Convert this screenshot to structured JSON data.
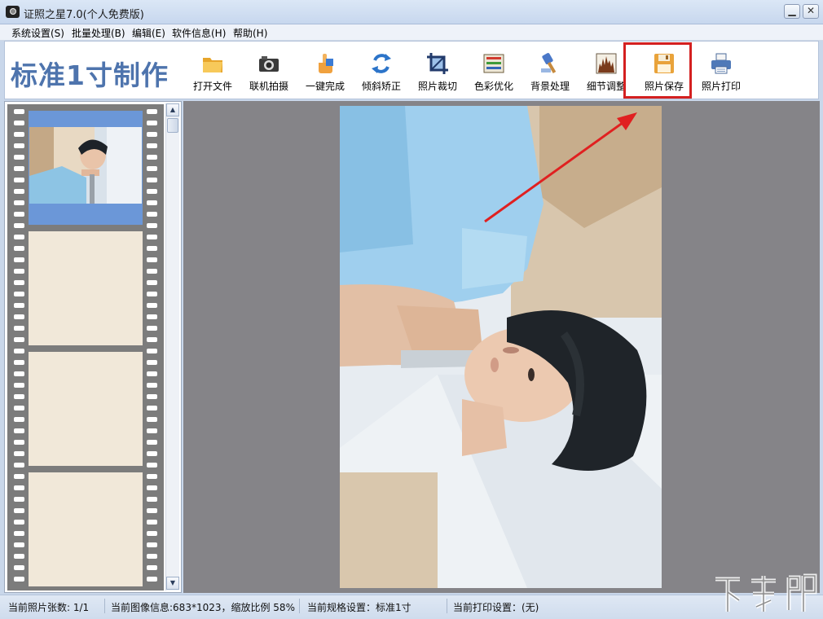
{
  "window": {
    "title": "证照之星7.0(个人免费版)",
    "minimize_glyph": "▁",
    "close_glyph": "✕"
  },
  "menu": {
    "items": [
      {
        "label": "系统设置(S)"
      },
      {
        "label": "批量处理(B)"
      },
      {
        "label": "编辑(E)"
      },
      {
        "label": "软件信息(H)"
      },
      {
        "label": "帮助(H)"
      }
    ]
  },
  "toolbar": {
    "logo_text": "标准1寸制作",
    "tools": [
      {
        "label": "打开文件",
        "icon": "folder-icon"
      },
      {
        "label": "联机拍摄",
        "icon": "camera-icon"
      },
      {
        "label": "一键完成",
        "icon": "hand-pointer-icon"
      },
      {
        "label": "倾斜矫正",
        "icon": "rotate-icon"
      },
      {
        "label": "照片裁切",
        "icon": "crop-icon"
      },
      {
        "label": "色彩优化",
        "icon": "color-icon"
      },
      {
        "label": "背景处理",
        "icon": "brush-icon"
      },
      {
        "label": "细节调整",
        "icon": "histogram-icon"
      },
      {
        "label": "照片保存",
        "icon": "floppy-icon",
        "highlighted": true
      },
      {
        "label": "照片打印",
        "icon": "printer-icon"
      }
    ],
    "highlight_color": "#d42020"
  },
  "filmstrip": {
    "scroll_up_glyph": "▲",
    "scroll_down_glyph": "▼",
    "active_frame_color": "#6b97d8",
    "empty_frame_color": "#f1e8d9"
  },
  "annotation": {
    "arrow_color": "#e02020"
  },
  "status": {
    "photo_count": "当前照片张数: 1/1",
    "image_info": "当前图像信息:683*1023，缩放比例 58%",
    "spec": "当前规格设置：标准1寸",
    "print": "当前打印设置：(无)"
  },
  "watermark": {
    "text": "下载吧"
  }
}
